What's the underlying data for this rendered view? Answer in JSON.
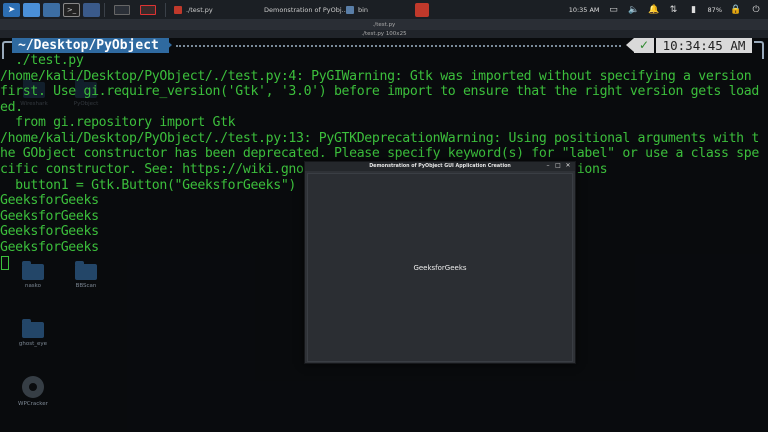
{
  "taskbar": {
    "tasks": [
      {
        "label": "./test.py",
        "color": "#c0392b"
      },
      {
        "label": "Demonstration of PyObj...",
        "color": "#c0392b"
      },
      {
        "label": "bin",
        "color": "#5a7fa8"
      }
    ],
    "clock": "10:35 AM",
    "battery": "87%"
  },
  "terminal": {
    "window_title": "./test.py",
    "sub_title": "./test.py 100x25",
    "prompt_path": "~/Desktop/PyObject",
    "prompt_time": "10:34:45 AM",
    "prompt_status": "✓",
    "lines": [
      "  ./test.py",
      "/home/kali/Desktop/PyObject/./test.py:4: PyGIWarning: Gtk was imported without specifying a version",
      "first. Use gi.require_version('Gtk', '3.0') before import to ensure that the right version gets load",
      "ed.",
      "  from gi.repository import Gtk",
      "/home/kali/Desktop/PyObject/./test.py:13: PyGTKDeprecationWarning: Using positional arguments with t",
      "he GObject constructor has been deprecated. Please specify keyword(s) for \"label\" or use a class spe",
      "cific constructor. See: https://wiki.gnome.org/PyGObject/InitializerDeprecations",
      "  button1 = Gtk.Button(\"GeeksforGeeks\")",
      "GeeksforGeeks",
      "GeeksforGeeks",
      "GeeksforGeeks",
      "GeeksforGeeks"
    ]
  },
  "desktop": {
    "icons": [
      "Wireshark",
      "PyObject",
      "nasko",
      "BBScan",
      "ghost_eye",
      "WPCracker"
    ]
  },
  "app": {
    "title": "Demonstration of PyObject GUI Application Creation",
    "button_label": "GeeksforGeeks",
    "minimize": "–",
    "maximize": "□",
    "close": "✕"
  }
}
